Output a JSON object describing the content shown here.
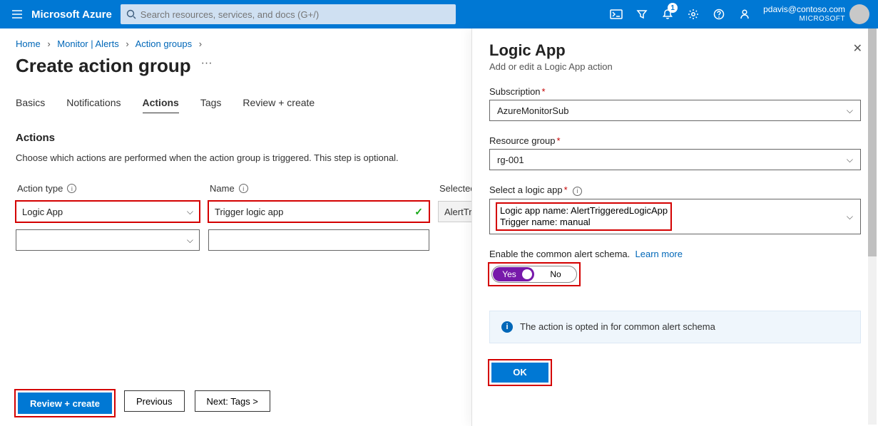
{
  "topbar": {
    "brand": "Microsoft Azure",
    "search_placeholder": "Search resources, services, and docs (G+/)",
    "notification_badge": "1",
    "user_email": "pdavis@contoso.com",
    "user_tenant": "MICROSOFT"
  },
  "breadcrumb": {
    "items": [
      "Home",
      "Monitor | Alerts",
      "Action groups"
    ]
  },
  "page": {
    "title": "Create action group",
    "tabs": [
      "Basics",
      "Notifications",
      "Actions",
      "Tags",
      "Review + create"
    ],
    "active_tab": "Actions",
    "section_heading": "Actions",
    "description": "Choose which actions are performed when the action group is triggered. This step is optional.",
    "columns": {
      "action_type": "Action type",
      "name": "Name",
      "selected": "Selected"
    },
    "rows": {
      "action_type_value": "Logic App",
      "name_value": "Trigger logic app",
      "selected_value": "AlertTrig"
    },
    "footer": {
      "review": "Review + create",
      "previous": "Previous",
      "next": "Next: Tags >"
    }
  },
  "panel": {
    "title": "Logic App",
    "subtitle": "Add or edit a Logic App action",
    "subscription_label": "Subscription",
    "subscription_value": "AzureMonitorSub",
    "rg_label": "Resource group",
    "rg_value": "rg-001",
    "logicapp_label": "Select a logic app",
    "logicapp_line1": "Logic app name: AlertTriggeredLogicApp",
    "logicapp_line2": "Trigger name: manual",
    "schema_label": "Enable the common alert schema.",
    "learn_more": "Learn more",
    "yes": "Yes",
    "no": "No",
    "info_text": "The action is opted in for common alert schema",
    "ok": "OK"
  }
}
